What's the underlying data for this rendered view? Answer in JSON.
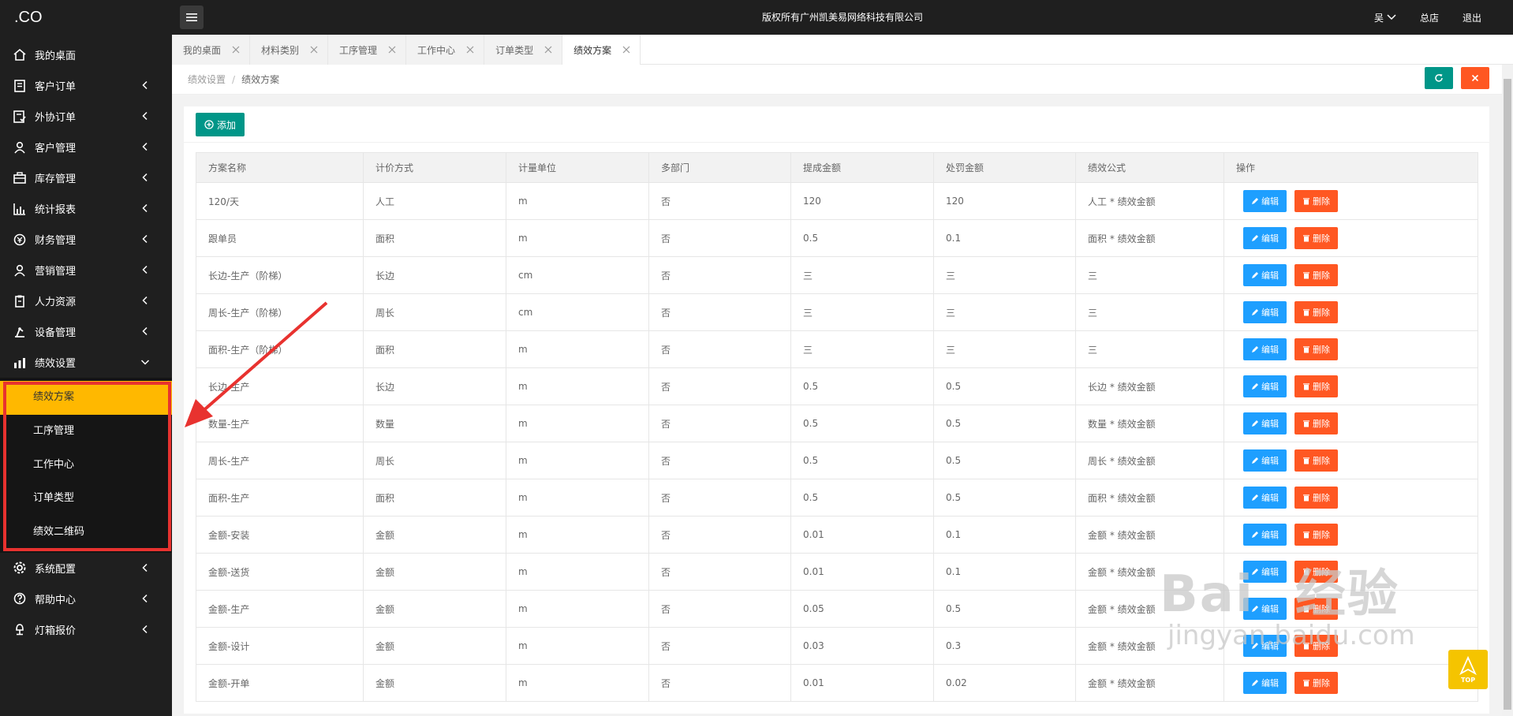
{
  "app": {
    "logo": ".CO",
    "copyright": "版权所有广州凯美易网络科技有限公司",
    "user": "吴",
    "store_link": "总店",
    "logout_link": "退出"
  },
  "sidebar": {
    "items": [
      {
        "label": "我的桌面",
        "icon": "home-icon",
        "arrow": false
      },
      {
        "label": "客户订单",
        "icon": "document-icon",
        "arrow": true
      },
      {
        "label": "外协订单",
        "icon": "checklist-icon",
        "arrow": true
      },
      {
        "label": "客户管理",
        "icon": "users-icon",
        "arrow": true
      },
      {
        "label": "库存管理",
        "icon": "box-icon",
        "arrow": true
      },
      {
        "label": "统计报表",
        "icon": "chart-icon",
        "arrow": true
      },
      {
        "label": "财务管理",
        "icon": "finance-icon",
        "arrow": true
      },
      {
        "label": "营销管理",
        "icon": "users-icon",
        "arrow": true
      },
      {
        "label": "人力资源",
        "icon": "clipboard-icon",
        "arrow": true
      },
      {
        "label": "设备管理",
        "icon": "machine-icon",
        "arrow": true
      },
      {
        "label": "绩效设置",
        "icon": "performance-icon",
        "arrow": "open"
      }
    ],
    "subitems": [
      "绩效方案",
      "工序管理",
      "工作中心",
      "订单类型",
      "绩效二维码"
    ],
    "active_subitem": 0,
    "bottom_items": [
      {
        "label": "系统配置",
        "icon": "gear-icon"
      },
      {
        "label": "帮助中心",
        "icon": "help-icon"
      },
      {
        "label": "灯箱报价",
        "icon": "lamp-icon"
      }
    ]
  },
  "tabs": [
    {
      "label": "我的桌面",
      "active": false
    },
    {
      "label": "材料类别",
      "active": false
    },
    {
      "label": "工序管理",
      "active": false
    },
    {
      "label": "工作中心",
      "active": false
    },
    {
      "label": "订单类型",
      "active": false
    },
    {
      "label": "绩效方案",
      "active": true
    }
  ],
  "breadcrumb": {
    "parent": "绩效设置",
    "separator": "/",
    "current": "绩效方案"
  },
  "toolbar": {
    "add_label": "添加"
  },
  "table": {
    "columns": [
      "方案名称",
      "计价方式",
      "计量单位",
      "多部门",
      "提成金额",
      "处罚金额",
      "绩效公式",
      "操作"
    ],
    "edit_label": "编辑",
    "delete_label": "删除",
    "rows": [
      [
        "120/天",
        "人工",
        "m",
        "否",
        "120",
        "120",
        "人工 * 绩效金额"
      ],
      [
        "跟单员",
        "面积",
        "m",
        "否",
        "0.5",
        "0.1",
        "面积 * 绩效金额"
      ],
      [
        "长边-生产（阶梯）",
        "长边",
        "cm",
        "否",
        "三",
        "三",
        "三"
      ],
      [
        "周长-生产（阶梯）",
        "周长",
        "cm",
        "否",
        "三",
        "三",
        "三"
      ],
      [
        "面积-生产（阶梯）",
        "面积",
        "m",
        "否",
        "三",
        "三",
        "三"
      ],
      [
        "长边-生产",
        "长边",
        "m",
        "否",
        "0.5",
        "0.5",
        "长边 * 绩效金额"
      ],
      [
        "数量-生产",
        "数量",
        "m",
        "否",
        "0.5",
        "0.5",
        "数量 * 绩效金额"
      ],
      [
        "周长-生产",
        "周长",
        "m",
        "否",
        "0.5",
        "0.5",
        "周长 * 绩效金额"
      ],
      [
        "面积-生产",
        "面积",
        "m",
        "否",
        "0.5",
        "0.5",
        "面积 * 绩效金额"
      ],
      [
        "金额-安装",
        "金额",
        "m",
        "否",
        "0.01",
        "0.1",
        "金额 * 绩效金额"
      ],
      [
        "金额-送货",
        "金额",
        "m",
        "否",
        "0.01",
        "0.1",
        "金额 * 绩效金额"
      ],
      [
        "金额-生产",
        "金额",
        "m",
        "否",
        "0.05",
        "0.5",
        "金额 * 绩效金额"
      ],
      [
        "金额-设计",
        "金额",
        "m",
        "否",
        "0.03",
        "0.3",
        "金额 * 绩效金额"
      ],
      [
        "金额-开单",
        "金额",
        "m",
        "否",
        "0.01",
        "0.02",
        "金额 * 绩效金额"
      ]
    ]
  },
  "watermark": {
    "brand": "Bai",
    "brand_suffix": "经验",
    "url": "jingyan.baidu.com"
  },
  "top_button_label": "TOP",
  "colors": {
    "sidebar_bg": "#1f1f1f",
    "active_submenu": "#ffb800",
    "add_button": "#009688",
    "edit_button": "#1e9fff",
    "delete_button": "#ff5722",
    "annotation": "#e8322f"
  }
}
